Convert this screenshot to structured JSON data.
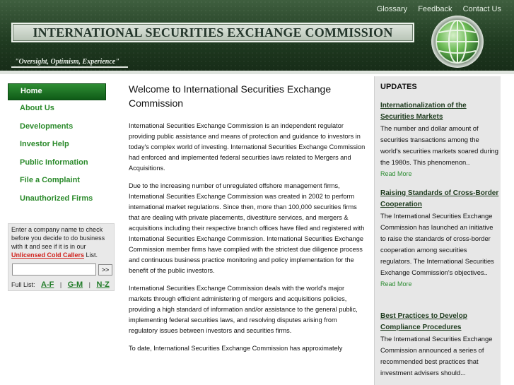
{
  "header": {
    "top_links": [
      "Glossary",
      "Feedback",
      "Contact Us"
    ],
    "title": "INTERNATIONAL SECURITIES EXCHANGE COMMISSION",
    "tagline": "\"Oversight, Optimism, Experience\""
  },
  "nav": {
    "items": [
      {
        "label": "Home",
        "active": true
      },
      {
        "label": "About Us"
      },
      {
        "label": "Developments"
      },
      {
        "label": "Investor Help"
      },
      {
        "label": "Public Information"
      },
      {
        "label": "File a Complaint"
      },
      {
        "label": "Unauthorized Firms"
      }
    ]
  },
  "lookup": {
    "desc_before": "Enter a company name to check before you decide to do business with it and see if it is in our ",
    "link": "Unlicensed Cold Callers",
    "desc_after": " List.",
    "input_value": "",
    "go_label": ">>",
    "full_list_label": "Full List:",
    "ranges": [
      "A-F",
      "G-M",
      "N-Z"
    ],
    "separator": "|"
  },
  "main": {
    "heading": "Welcome to International Securities Exchange Commission",
    "paragraphs": [
      "International Securities Exchange Commission is an independent regulator providing public assistance and means of protection and guidance to investors in today's complex world of investing. International Securities Exchange Commission had enforced and implemented federal securities laws related to Mergers and Acquisitions.",
      "Due to the increasing number of unregulated offshore management firms, International Securities Exchange Commission was created in 2002 to perform international market regulations. Since then, more than 100,000 securities firms that are dealing with private placements, divestiture services, and mergers & acquisitions including their respective branch offices have filed and registered with International Securities Exchange Commission. International Securities Exchange Commission member firms have complied with the strictest due diligence process and continuous business practice monitoring and policy implementation for the benefit of the public investors.",
      "International Securities Exchange Commission deals with the world's major markets through efficient administering of mergers and acquisitions policies, providing a high standard of information and/or assistance to the general public, implementing federal securities laws, and resolving disputes arising from regulatory issues between investors and securities firms.",
      "To date, International Securities Exchange Commission has approximately"
    ]
  },
  "updates": {
    "title": "UPDATES",
    "items": [
      {
        "headline": "Internationalization of the Securities Markets",
        "body": "The number and dollar amount of securities transactions among the world's securities markets soared during the 1980s. This phenomenon..",
        "more": "Read More"
      },
      {
        "headline": "Raising Standards of Cross-Border Cooperation",
        "body": "The International Securities Exchange Commission has launched an initiative to raise the standards of cross-border cooperation among securities regulators. The International Securities Exchange Commission's objectives..",
        "more": "Read More"
      },
      {
        "headline": "Best Practices to Develop Compliance Procedures",
        "body": "The International Securities Exchange Commission announced a series of recommended best practices that investment advisers should...",
        "more": ""
      }
    ]
  }
}
